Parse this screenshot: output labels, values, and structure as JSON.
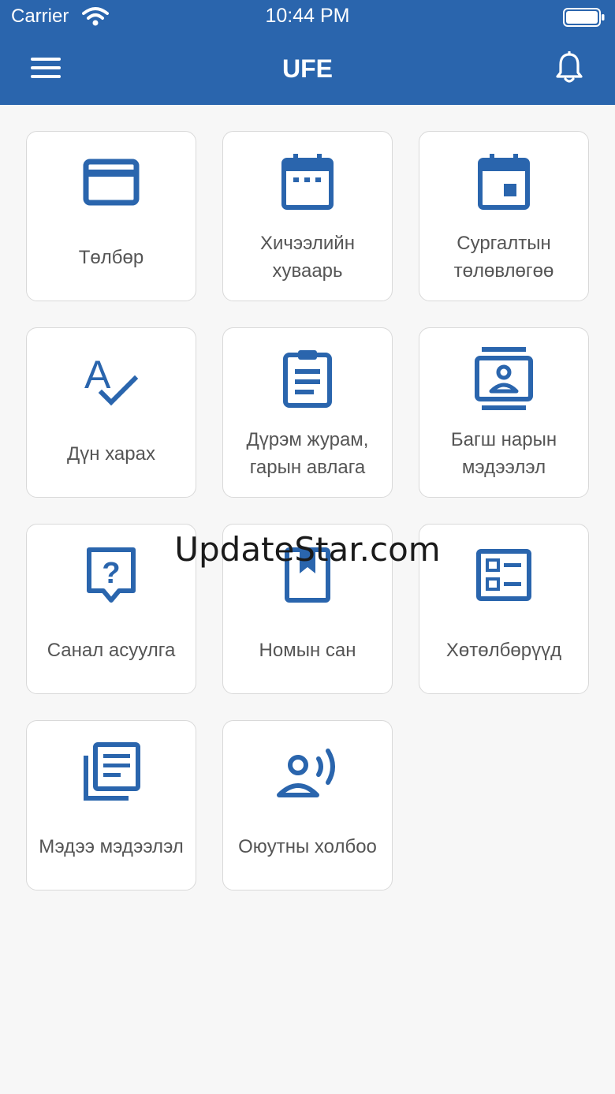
{
  "status_bar": {
    "carrier": "Carrier",
    "time": "10:44 PM"
  },
  "header": {
    "title": "UFE",
    "menu_icon": "hamburger-menu-icon",
    "notification_icon": "bell-icon"
  },
  "tiles": [
    {
      "label": "Төлбөр",
      "icon": "credit-card-icon"
    },
    {
      "label": "Хичээлийн хуваарь",
      "icon": "calendar-icon"
    },
    {
      "label": "Сургалтын төлөвлөгөө",
      "icon": "calendar-day-icon"
    },
    {
      "label": "Дүн харах",
      "icon": "spellcheck-icon"
    },
    {
      "label": "Дүрэм журам, гарын авлага",
      "icon": "clipboard-icon"
    },
    {
      "label": "Багш нарын мэдээлэл",
      "icon": "contact-card-icon"
    },
    {
      "label": "Санал асуулга",
      "icon": "question-bubble-icon"
    },
    {
      "label": "Номын сан",
      "icon": "bookmark-book-icon"
    },
    {
      "label": "Хөтөлбөрүүд",
      "icon": "list-checkbox-icon"
    },
    {
      "label": "Мэдээ мэдээлэл",
      "icon": "news-library-icon"
    },
    {
      "label": "Оюутны холбоо",
      "icon": "user-voice-icon"
    }
  ],
  "watermark": "UpdateStar.com",
  "colors": {
    "primary": "#2a65ad",
    "background": "#f7f7f7",
    "tile_border": "#d9d9d9",
    "label_text": "#555555"
  }
}
